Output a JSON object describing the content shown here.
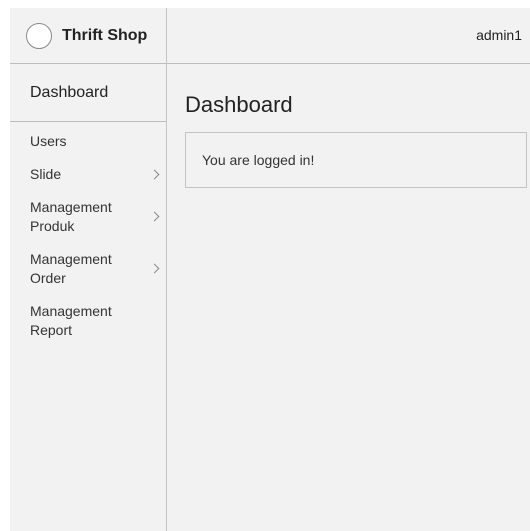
{
  "app": {
    "brand": "Thrift Shop",
    "user": "admin1"
  },
  "sidebar": {
    "title": "Dashboard",
    "items": [
      {
        "label": "Users",
        "has_children": false
      },
      {
        "label": "Slide",
        "has_children": true
      },
      {
        "label": "Management Produk",
        "has_children": true
      },
      {
        "label": "Management Order",
        "has_children": true
      },
      {
        "label": "Management Report",
        "has_children": false
      }
    ]
  },
  "main": {
    "title": "Dashboard",
    "message": "You are logged in!"
  },
  "icons": {
    "logo": "circle-logo-icon",
    "submenu": "chevron-right-icon"
  },
  "colors": {
    "background": "#f2f2f2",
    "border": "#bdbdbd",
    "text": "#222222"
  }
}
